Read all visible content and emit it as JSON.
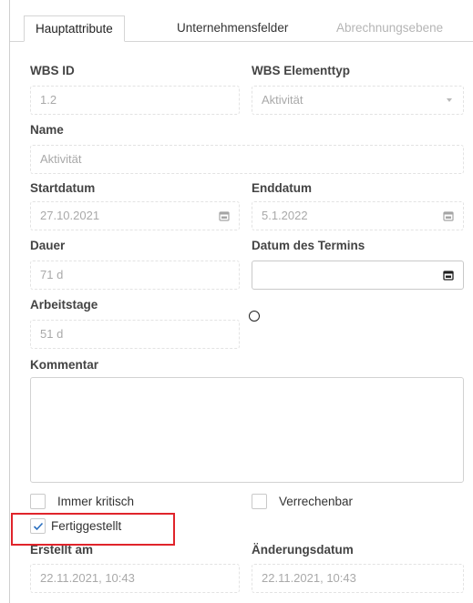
{
  "tabs": [
    {
      "label": "Hauptattribute",
      "state": "active"
    },
    {
      "label": "Unternehmensfelder",
      "state": "normal"
    },
    {
      "label": "Abrechnungsebene",
      "state": "disabled"
    }
  ],
  "fields": {
    "wbs_id": {
      "label": "WBS ID",
      "value": "1.2"
    },
    "wbs_type": {
      "label": "WBS Elementtyp",
      "value": "Aktivität"
    },
    "name": {
      "label": "Name",
      "value": "Aktivität"
    },
    "start_date": {
      "label": "Startdatum",
      "value": "27.10.2021"
    },
    "end_date": {
      "label": "Enddatum",
      "value": "5.1.2022"
    },
    "duration": {
      "label": "Dauer",
      "value": "71 d"
    },
    "appointment_date": {
      "label": "Datum des Termins",
      "value": ""
    },
    "work_days": {
      "label": "Arbeitstage",
      "value": "51 d"
    },
    "comment": {
      "label": "Kommentar",
      "value": ""
    },
    "created": {
      "label": "Erstellt am",
      "value": "22.11.2021, 10:43"
    },
    "modified": {
      "label": "Änderungsdatum",
      "value": "22.11.2021, 10:43"
    }
  },
  "checkboxes": {
    "always_critical": {
      "label": "Immer kritisch",
      "checked": false
    },
    "billable": {
      "label": "Verrechenbar",
      "checked": false
    },
    "completed": {
      "label": "Fertiggestellt",
      "checked": true
    }
  },
  "colors": {
    "highlight": "#e0242b",
    "check": "#2a6fbf"
  }
}
